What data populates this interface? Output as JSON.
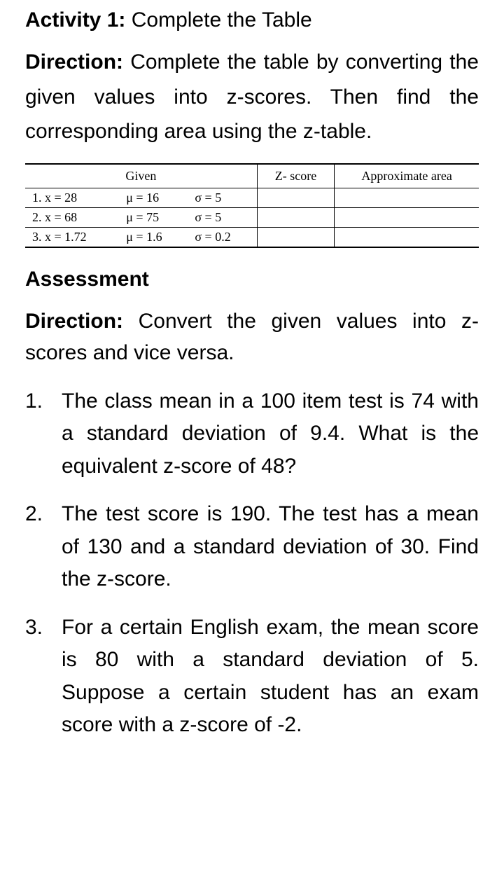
{
  "activity": {
    "label": "Activity 1:",
    "title": "Complete the Table"
  },
  "direction1": {
    "label": "Direction:",
    "text": "Complete the table by converting the given values into z-scores. Then find the corresponding area using the z-table."
  },
  "table": {
    "headers": {
      "given": "Given",
      "zscore": "Z- score",
      "area": "Approximate area"
    },
    "rows": [
      {
        "x": "1. x = 28",
        "mu": "μ = 16",
        "sigma": "σ = 5",
        "z": "",
        "area": ""
      },
      {
        "x": "2. x = 68",
        "mu": "μ = 75",
        "sigma": "σ = 5",
        "z": "",
        "area": ""
      },
      {
        "x": "3. x = 1.72",
        "mu": "μ = 1.6",
        "sigma": "σ = 0.2",
        "z": "",
        "area": ""
      }
    ]
  },
  "assessment_heading": "Assessment",
  "direction2": {
    "label": "Direction:",
    "text": "Convert the given values into z-scores and vice versa."
  },
  "questions": [
    {
      "num": "1.",
      "text": "The class mean in a 100 item test is 74 with a standard deviation of 9.4. What is the equivalent z-score of 48?"
    },
    {
      "num": "2.",
      "text": "The test score is 190. The test has a mean of 130 and a standard devi­ation of 30. Find the z-score."
    },
    {
      "num": "3.",
      "text": "For a certain English exam, the mean score is 80 with a standard deviation of 5. Suppose a certain student has an exam score with a z-score of -2."
    }
  ]
}
